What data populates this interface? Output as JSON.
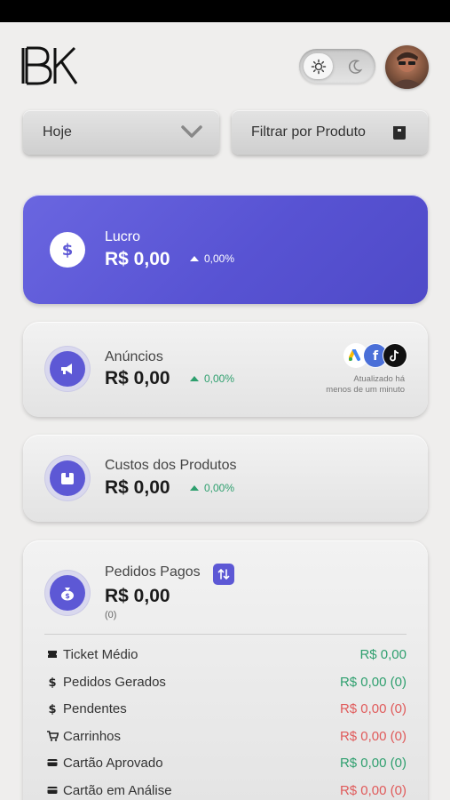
{
  "header": {
    "logo_text": "BK",
    "theme": {
      "mode": "light",
      "sun_icon": "sun-icon",
      "moon_icon": "moon-icon"
    },
    "avatar_icon": "user-avatar"
  },
  "filters": {
    "period": {
      "selected": "Hoje",
      "icon": "chevron-down-icon"
    },
    "product_filter": {
      "label": "Filtrar por Produto",
      "icon": "box-icon"
    }
  },
  "cards": {
    "lucro": {
      "title": "Lucro",
      "value": "R$ 0,00",
      "change": "0,00%",
      "icon": "dollar-icon"
    },
    "anuncios": {
      "title": "Anúncios",
      "value": "R$ 0,00",
      "change": "0,00%",
      "icon": "megaphone-icon",
      "platforms": [
        "google-ads-icon",
        "facebook-icon",
        "tiktok-icon"
      ],
      "updated_line1": "Atualizado há",
      "updated_line2": "menos de um minuto"
    },
    "custos": {
      "title": "Custos dos Produtos",
      "value": "R$ 0,00",
      "change": "0,00%",
      "icon": "box-icon"
    },
    "pedidos": {
      "title": "Pedidos Pagos",
      "value": "R$ 0,00",
      "count": "(0)",
      "icon": "money-bag-icon",
      "swap_icon": "swap-vertical-icon",
      "rows": [
        {
          "label": "Ticket Médio",
          "value": "R$ 0,00",
          "icon": "ticket-icon"
        },
        {
          "label": "Pedidos Gerados",
          "value": "R$ 0,00 (0)",
          "icon": "dollar-icon"
        },
        {
          "label": "Pendentes",
          "value": "R$ 0,00 (0)",
          "icon": "dollar-icon"
        },
        {
          "label": "Carrinhos",
          "value": "R$ 0,00 (0)",
          "icon": "cart-icon"
        },
        {
          "label": "Cartão Aprovado",
          "value": "R$ 0,00 (0)",
          "icon": "card-icon"
        },
        {
          "label": "Cartão em Análise",
          "value": "R$ 0,00 (0)",
          "icon": "card-icon"
        }
      ]
    }
  },
  "colors": {
    "accent": "#5d58d5",
    "positive": "#2e9f6e",
    "negative": "#e05a5a",
    "background": "#efeeed"
  }
}
